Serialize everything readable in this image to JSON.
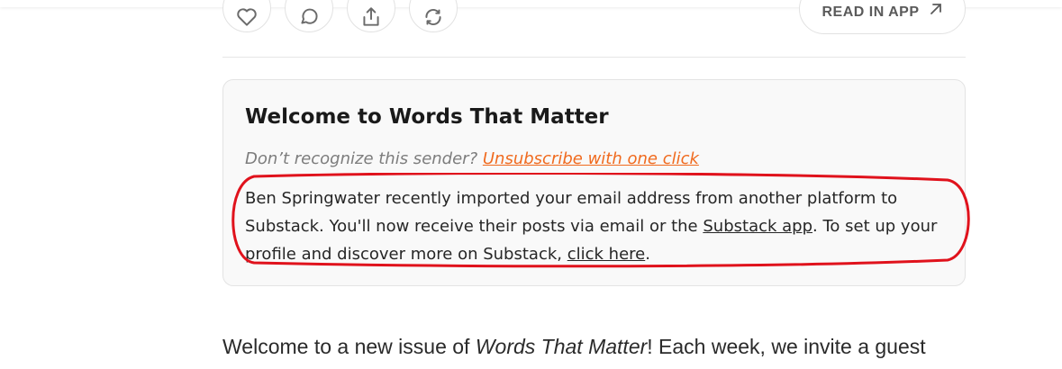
{
  "actions": {
    "like_icon": "heart-icon",
    "comment_icon": "comment-icon",
    "share_icon": "share-icon",
    "restack_icon": "restack-icon",
    "read_in_app_label": "READ IN APP",
    "read_in_app_icon": "arrow-up-right-icon"
  },
  "card": {
    "title": "Welcome to Words That Matter",
    "sender_prompt": "Don’t recognize this sender?",
    "unsubscribe_link": "Unsubscribe with one click",
    "import_text_1": "Ben Springwater recently imported your email address from another platform to Substack. You'll now receive their posts via email or the",
    "substack_app_link": "Substack app",
    "import_text_2": ". To set up your profile and discover more on Substack,",
    "click_here_link": "click here",
    "import_text_3": "."
  },
  "article": {
    "intro_prefix": "Welcome to a new issue of",
    "intro_pub_name": "Words That Matter",
    "intro_suffix": "! Each week, we invite a guest"
  },
  "colors": {
    "link_accent": "#f06a1e",
    "highlight_ring": "#e0121c",
    "card_background": "#f9f9f9"
  }
}
